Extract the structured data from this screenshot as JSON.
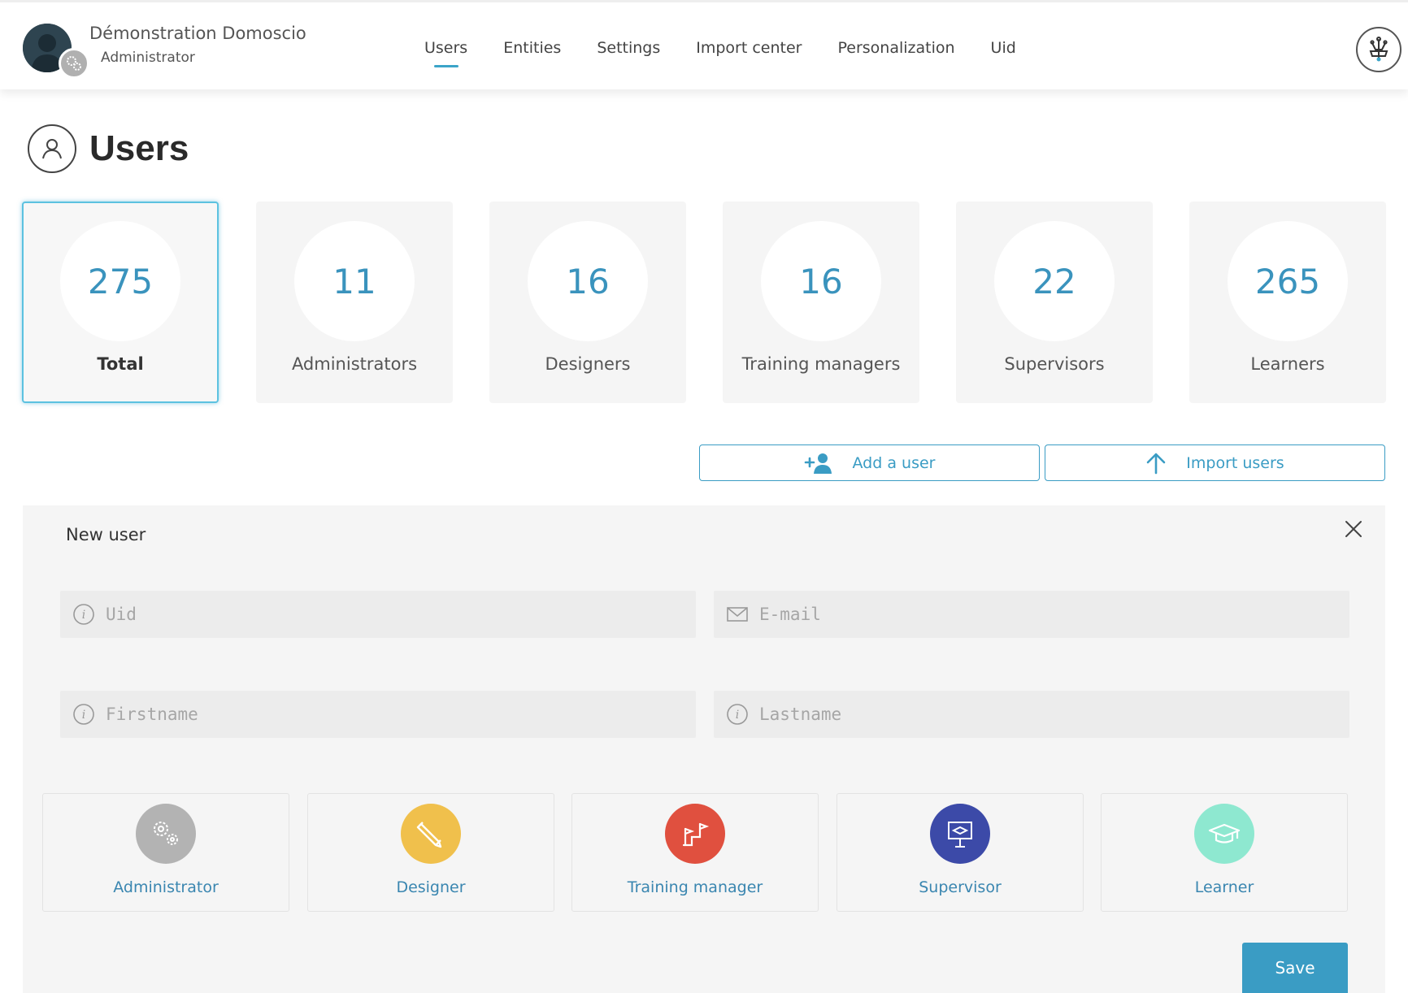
{
  "header": {
    "user_name": "Démonstration Domoscio",
    "user_role": "Administrator",
    "nav": [
      {
        "label": "Users",
        "active": true
      },
      {
        "label": "Entities",
        "active": false
      },
      {
        "label": "Settings",
        "active": false
      },
      {
        "label": "Import center",
        "active": false
      },
      {
        "label": "Personalization",
        "active": false
      },
      {
        "label": "Uid",
        "active": false
      }
    ],
    "brand_icon": "domoscio-logo-icon"
  },
  "page": {
    "title": "Users",
    "title_icon": "user-icon"
  },
  "stats": [
    {
      "value": "275",
      "label": "Total",
      "selected": true
    },
    {
      "value": "11",
      "label": "Administrators",
      "selected": false
    },
    {
      "value": "16",
      "label": "Designers",
      "selected": false
    },
    {
      "value": "16",
      "label": "Training managers",
      "selected": false
    },
    {
      "value": "22",
      "label": "Supervisors",
      "selected": false
    },
    {
      "value": "265",
      "label": "Learners",
      "selected": false
    }
  ],
  "actions": {
    "add_user": "Add a user",
    "import_users": "Import users"
  },
  "new_user_form": {
    "title": "New user",
    "fields": {
      "uid": {
        "placeholder": "Uid",
        "value": ""
      },
      "email": {
        "placeholder": "E-mail",
        "value": ""
      },
      "firstname": {
        "placeholder": "Firstname",
        "value": ""
      },
      "lastname": {
        "placeholder": "Lastname",
        "value": ""
      }
    },
    "roles": [
      {
        "label": "Administrator",
        "icon": "gears-icon",
        "color": "#b3b3b3"
      },
      {
        "label": "Designer",
        "icon": "pencil-icon",
        "color": "#f0c04c"
      },
      {
        "label": "Training manager",
        "icon": "flags-icon",
        "color": "#e0503f"
      },
      {
        "label": "Supervisor",
        "icon": "presentation-board-icon",
        "color": "#3c4aa8"
      },
      {
        "label": "Learner",
        "icon": "graduation-cap-icon",
        "color": "#8ee8d0"
      }
    ],
    "save": "Save"
  },
  "colors": {
    "accent": "#3a9cc4",
    "stat_value": "#3a93bd",
    "active_border": "#5cc2e0",
    "panel_bg": "#f5f5f5"
  }
}
